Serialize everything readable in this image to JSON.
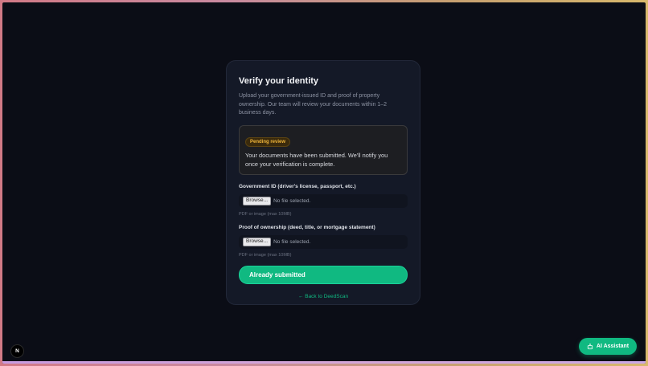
{
  "card": {
    "title": "Verify your identity",
    "subtitle": "Upload your government-issued ID and proof of property ownership. Our team will review your documents within 1–2 business days.",
    "status_badge": "Pending review",
    "status_message": "Your documents have been submitted. We'll notify you once your verification is complete.",
    "fields": [
      {
        "label": "Government ID (driver's license, passport, etc.)",
        "browse_label": "Browse...",
        "file_status": "No file selected.",
        "hint": "PDF or image (max 10MB)"
      },
      {
        "label": "Proof of ownership (deed, title, or mortgage statement)",
        "browse_label": "Browse...",
        "file_status": "No file selected.",
        "hint": "PDF or image (max 10MB)"
      }
    ],
    "submit_label": "Already submitted",
    "back_link": "← Back to DeedScan"
  },
  "dev_badge": {
    "label": "N",
    "icon": "nextjs-icon"
  },
  "assistant_button": {
    "label": "AI Assistant",
    "icon": "robot-icon"
  },
  "colors": {
    "accent": "#10b981",
    "background": "#0b0d16",
    "card": "#141927",
    "badge_text": "#f0b53a"
  }
}
